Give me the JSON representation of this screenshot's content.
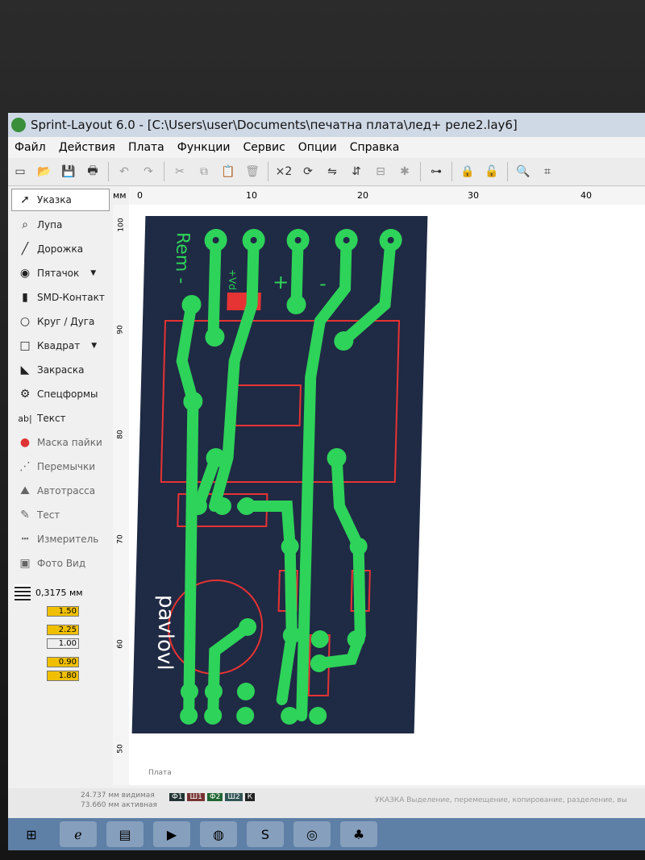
{
  "window": {
    "title": "Sprint-Layout 6.0 - [C:\\Users\\user\\Documents\\печатна плата\\лед+ реле2.lay6]"
  },
  "menu": [
    "Файл",
    "Действия",
    "Плата",
    "Функции",
    "Сервис",
    "Опции",
    "Справка"
  ],
  "tools": [
    {
      "label": "Указка",
      "icon": "pointer-icon"
    },
    {
      "label": "Лупа",
      "icon": "magnifier-icon"
    },
    {
      "label": "Дорожка",
      "icon": "track-icon"
    },
    {
      "label": "Пятачок",
      "icon": "pad-icon"
    },
    {
      "label": "SMD-Контакт",
      "icon": "smd-pad-icon"
    },
    {
      "label": "Круг / Дуга",
      "icon": "circle-icon"
    },
    {
      "label": "Квадрат",
      "icon": "square-icon"
    },
    {
      "label": "Закраска",
      "icon": "fill-icon"
    },
    {
      "label": "Спецформы",
      "icon": "special-shapes-icon"
    },
    {
      "label": "Текст",
      "icon": "text-icon"
    },
    {
      "label": "Маска пайки",
      "icon": "solder-mask-icon"
    },
    {
      "label": "Перемычки",
      "icon": "jumper-icon"
    },
    {
      "label": "Автотрасса",
      "icon": "autoroute-icon"
    },
    {
      "label": "Тест",
      "icon": "test-icon"
    },
    {
      "label": "Измеритель",
      "icon": "measure-icon"
    },
    {
      "label": "Фото Вид",
      "icon": "photo-view-icon"
    }
  ],
  "grid": {
    "label": "0,3175 мм"
  },
  "params": {
    "track": "1.50",
    "pad_outer": "2.25",
    "pad_inner": "1.00",
    "smd_w": "0.90",
    "smd_h": "1.80"
  },
  "ruler": {
    "unit": "мм",
    "top": [
      "0",
      "10",
      "20",
      "30",
      "40"
    ],
    "left": [
      "100",
      "90",
      "80",
      "70",
      "60",
      "50"
    ]
  },
  "board": {
    "texts": {
      "rem": "Rem -",
      "plus_label": "+",
      "minus_label": "-",
      "vd": "+Vd",
      "author": "pavlovl"
    }
  },
  "status": {
    "line1": "24.737 мм   видимая",
    "line2": "73.660 мм   активная",
    "layers": [
      "Ф1",
      "Ш1",
      "Ф2",
      "Ш2",
      "К"
    ],
    "hint": "УКАЗКА  Выделение, перемещение, копирование, разделение, вы",
    "tab": "Плата"
  },
  "colors": {
    "board": "#1f2a44",
    "copper": "#2ed35a",
    "silk": "#e63333"
  }
}
